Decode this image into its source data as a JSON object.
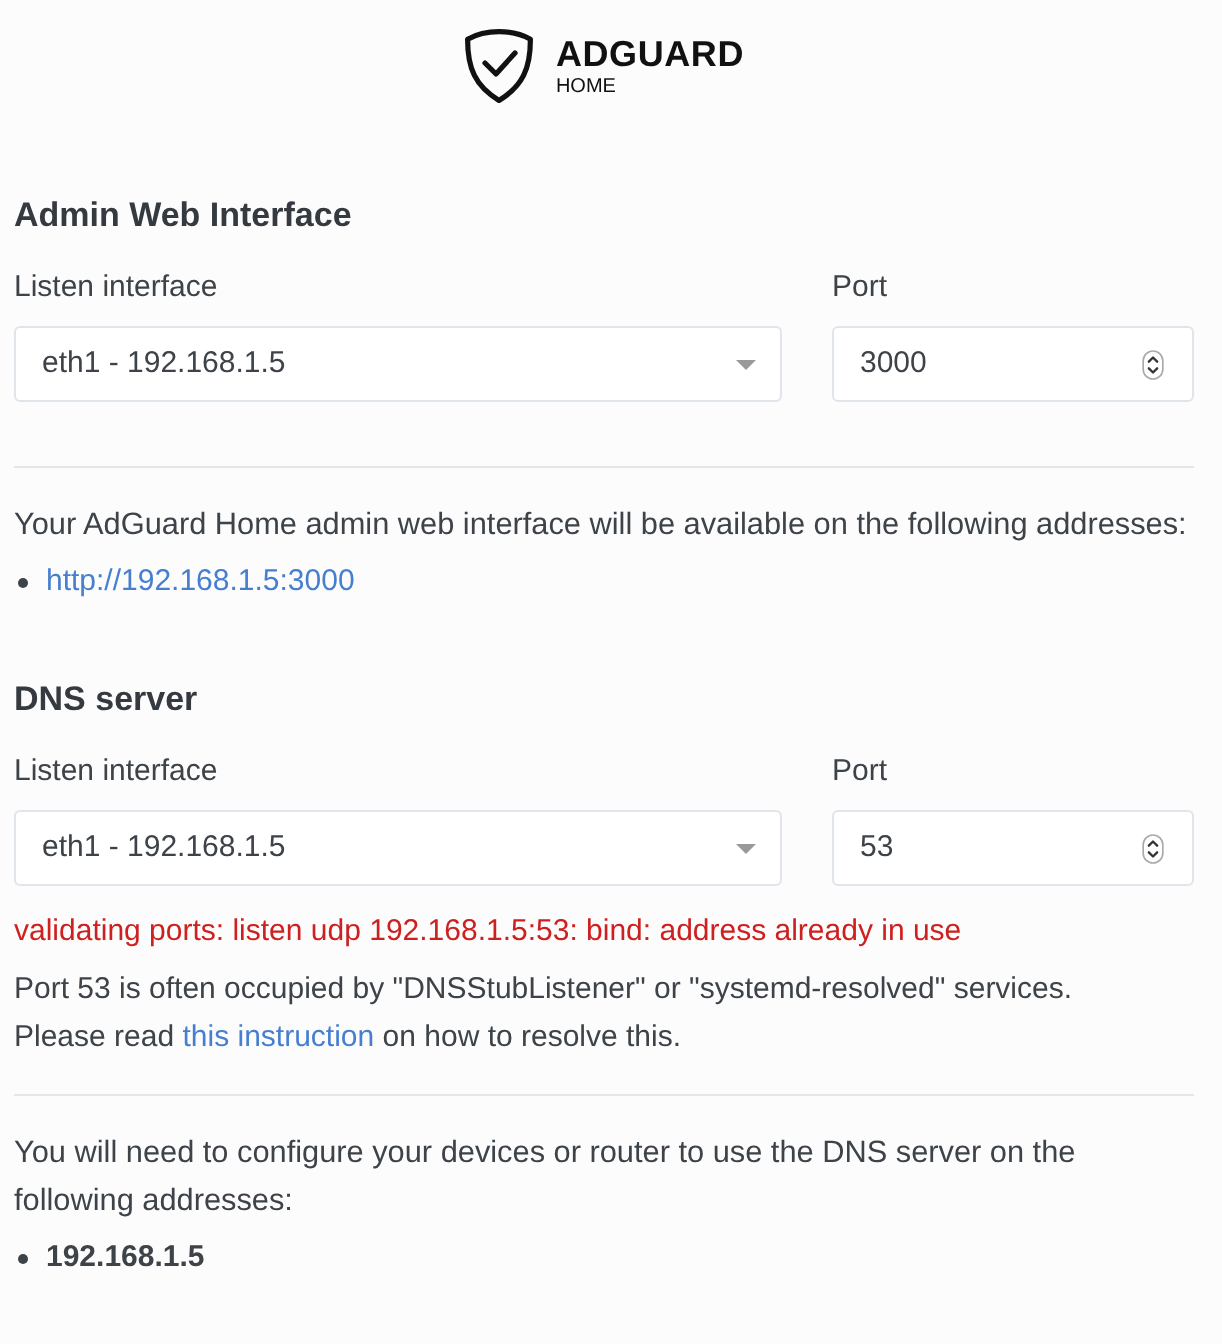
{
  "logo": {
    "name": "ADGUARD",
    "subtitle": "HOME"
  },
  "sections": [
    {
      "title": "Admin Web Interface",
      "fields": [
        {
          "kind": "select",
          "label": "Listen interface",
          "value": "eth1 - 192.168.1.5"
        },
        {
          "kind": "number",
          "label": "Port",
          "value": "3000"
        }
      ],
      "addresses_text": "Your AdGuard Home admin web interface will be available on the following addresses:",
      "addresses": [
        {
          "kind": "link",
          "text": "http://192.168.1.5:3000"
        }
      ]
    },
    {
      "title": "DNS server",
      "fields": [
        {
          "kind": "select",
          "label": "Listen interface",
          "value": "eth1 - 192.168.1.5"
        },
        {
          "kind": "number",
          "label": "Port",
          "value": "53"
        }
      ],
      "error": "validating ports: listen udp 192.168.1.5:53: bind: address already in use",
      "help": {
        "line_1": "Port 53 is often occupied by \"DNSStubListener\" or \"systemd-resolved\" services.",
        "before_link": "Please read",
        "link": "this instruction",
        "after_link": "on how to resolve this."
      },
      "addresses_text": "You will need to configure your devices or router to use the DNS server on the following addresses:",
      "addresses": [
        {
          "kind": "plain",
          "text": "192.168.1.5"
        }
      ]
    }
  ]
}
